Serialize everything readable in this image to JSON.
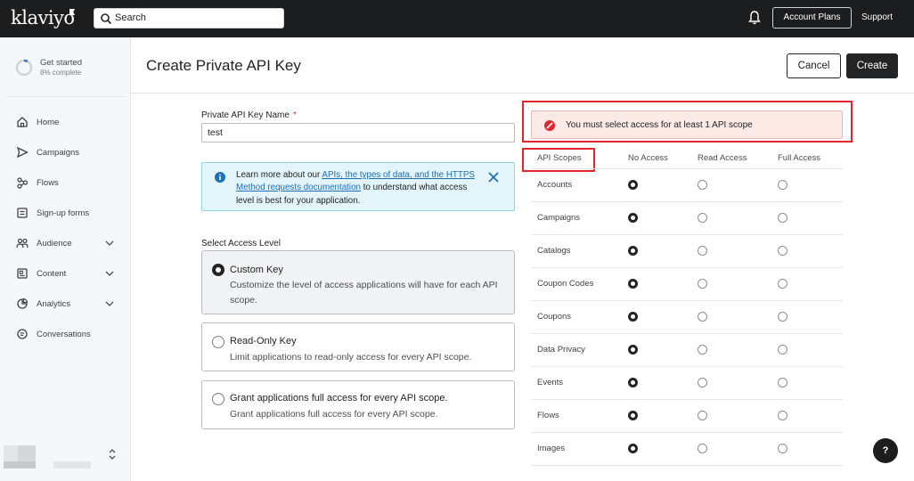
{
  "topbar": {
    "logo": "klaviyo",
    "search_placeholder": "Search",
    "account_plans": "Account Plans",
    "support": "Support"
  },
  "sidebar": {
    "get_started": {
      "title": "Get started",
      "subtitle": "8% complete",
      "progress": 0.08
    },
    "items": [
      {
        "label": "Home",
        "icon": "home-icon"
      },
      {
        "label": "Campaigns",
        "icon": "send-icon"
      },
      {
        "label": "Flows",
        "icon": "flows-icon"
      },
      {
        "label": "Sign-up forms",
        "icon": "form-icon"
      },
      {
        "label": "Audience",
        "icon": "audience-icon",
        "expandable": true
      },
      {
        "label": "Content",
        "icon": "content-icon",
        "expandable": true
      },
      {
        "label": "Analytics",
        "icon": "analytics-icon",
        "expandable": true
      },
      {
        "label": "Conversations",
        "icon": "chat-icon"
      }
    ]
  },
  "page": {
    "title": "Create Private API Key",
    "cancel": "Cancel",
    "create": "Create"
  },
  "form": {
    "key_name_label": "Private API Key Name",
    "required_mark": "*",
    "key_name_value": "test",
    "info": {
      "prefix": "Learn more about our ",
      "link": "APIs, the types of data, and the HTTPS Method requests documentation",
      "suffix": " to understand what access level is best for your application."
    },
    "access_level_label": "Select Access Level",
    "options": [
      {
        "title": "Custom Key",
        "desc": "Customize the level of access applications will have for each API scope.",
        "selected": true
      },
      {
        "title": "Read-Only Key",
        "desc": "Limit applications to read-only access for every API scope.",
        "selected": false
      },
      {
        "title": "Grant applications full access for every API scope.",
        "desc": "Grant applications full access for every API scope.",
        "selected": false
      }
    ]
  },
  "error": {
    "message": "You must select access for at least 1 API scope"
  },
  "scopes": {
    "headers": [
      "API Scopes",
      "No Access",
      "Read Access",
      "Full Access"
    ],
    "rows": [
      {
        "name": "Accounts",
        "access": "No Access"
      },
      {
        "name": "Campaigns",
        "access": "No Access"
      },
      {
        "name": "Catalogs",
        "access": "No Access"
      },
      {
        "name": "Coupon Codes",
        "access": "No Access"
      },
      {
        "name": "Coupons",
        "access": "No Access"
      },
      {
        "name": "Data Privacy",
        "access": "No Access"
      },
      {
        "name": "Events",
        "access": "No Access"
      },
      {
        "name": "Flows",
        "access": "No Access"
      },
      {
        "name": "Images",
        "access": "No Access"
      }
    ]
  },
  "help": "?",
  "colors": {
    "topbar": "#1c1d1f",
    "error_outline": "#e3252d",
    "info_bg": "#e3f4fb",
    "link": "#1d6fb8"
  }
}
